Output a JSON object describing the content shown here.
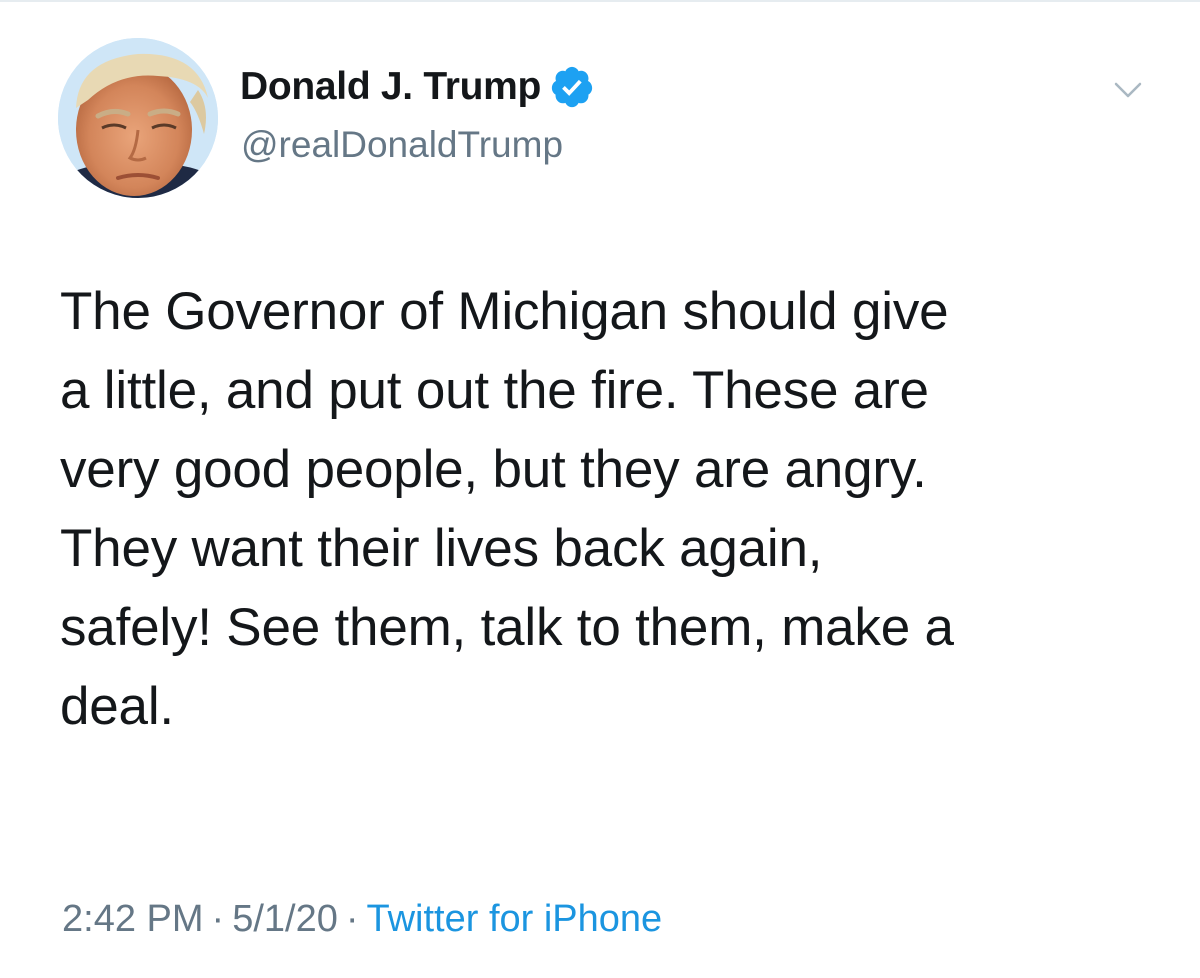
{
  "tweet": {
    "author_name": "Donald J. Trump",
    "handle": "@realDonaldTrump",
    "verified": true,
    "text": "The Governor of Michigan should give\na little, and put out the fire. These are\nvery good people, but they are angry.\nThey want their lives back again,\nsafely! See them, talk to them, make a\ndeal.",
    "time": "2:42 PM",
    "separator": "·",
    "date": "5/1/20",
    "source": "Twitter for iPhone"
  },
  "icons": {
    "verified": "verified-badge-icon",
    "menu": "chevron-down-icon",
    "avatar": "profile-photo"
  },
  "colors": {
    "text_primary": "#14171a",
    "text_secondary": "#657786",
    "link": "#1b95e0",
    "verified_blue": "#1da1f2"
  }
}
